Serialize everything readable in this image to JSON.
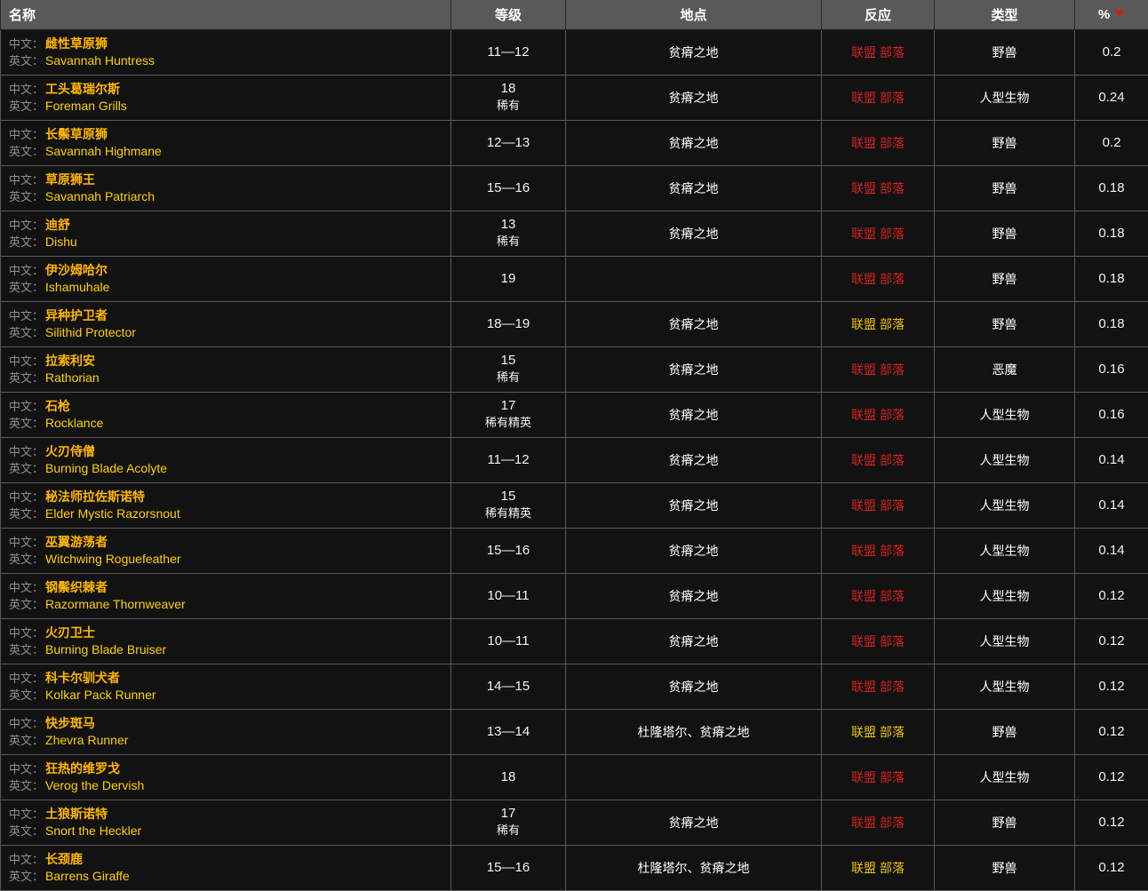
{
  "table": {
    "sort_indicator": "descending-caret",
    "accent_colors": {
      "header_background": "#595959",
      "row_background": "#121212",
      "grid_line": "#595959",
      "name_cn": "#ffb700",
      "name_en": "#ffd100",
      "label_grey": "#8f8f8f",
      "hostile_red": "#d32020",
      "neutral_yellow": "#e8c20a",
      "sort_caret_red": "#c62222"
    },
    "columns": [
      {
        "key": "name",
        "label": "名称"
      },
      {
        "key": "level",
        "label": "等级"
      },
      {
        "key": "location",
        "label": "地点"
      },
      {
        "key": "reaction",
        "label": "反应"
      },
      {
        "key": "type",
        "label": "类型"
      },
      {
        "key": "percent",
        "label": "%"
      }
    ],
    "labels": {
      "cn_prefix": "中文：",
      "en_prefix": "英文：",
      "alliance": "联盟",
      "horde": "部落"
    },
    "rows": [
      {
        "cn": "雌性草原狮",
        "en": "Savannah Huntress",
        "level": "11—12",
        "rank": "",
        "location": "贫瘠之地",
        "reaction": "hostile",
        "type": "野兽",
        "percent": "0.2"
      },
      {
        "cn": "工头葛瑞尔斯",
        "en": "Foreman Grills",
        "level": "18",
        "rank": "稀有",
        "location": "贫瘠之地",
        "reaction": "hostile",
        "type": "人型生物",
        "percent": "0.24"
      },
      {
        "cn": "长鬃草原狮",
        "en": "Savannah Highmane",
        "level": "12—13",
        "rank": "",
        "location": "贫瘠之地",
        "reaction": "hostile",
        "type": "野兽",
        "percent": "0.2"
      },
      {
        "cn": "草原狮王",
        "en": "Savannah Patriarch",
        "level": "15—16",
        "rank": "",
        "location": "贫瘠之地",
        "reaction": "hostile",
        "type": "野兽",
        "percent": "0.18"
      },
      {
        "cn": "迪舒",
        "en": "Dishu",
        "level": "13",
        "rank": "稀有",
        "location": "贫瘠之地",
        "reaction": "hostile",
        "type": "野兽",
        "percent": "0.18"
      },
      {
        "cn": "伊沙姆哈尔",
        "en": "Ishamuhale",
        "level": "19",
        "rank": "",
        "location": "",
        "reaction": "hostile",
        "type": "野兽",
        "percent": "0.18"
      },
      {
        "cn": "异种护卫者",
        "en": "Silithid Protector",
        "level": "18—19",
        "rank": "",
        "location": "贫瘠之地",
        "reaction": "neutral",
        "type": "野兽",
        "percent": "0.18"
      },
      {
        "cn": "拉索利安",
        "en": "Rathorian",
        "level": "15",
        "rank": "稀有",
        "location": "贫瘠之地",
        "reaction": "hostile",
        "type": "恶魔",
        "percent": "0.16"
      },
      {
        "cn": "石枪",
        "en": "Rocklance",
        "level": "17",
        "rank": "稀有精英",
        "location": "贫瘠之地",
        "reaction": "hostile",
        "type": "人型生物",
        "percent": "0.16"
      },
      {
        "cn": "火刃侍僧",
        "en": "Burning Blade Acolyte",
        "level": "11—12",
        "rank": "",
        "location": "贫瘠之地",
        "reaction": "hostile",
        "type": "人型生物",
        "percent": "0.14"
      },
      {
        "cn": "秘法师拉佐斯诺特",
        "en": "Elder Mystic Razorsnout",
        "level": "15",
        "rank": "稀有精英",
        "location": "贫瘠之地",
        "reaction": "hostile",
        "type": "人型生物",
        "percent": "0.14"
      },
      {
        "cn": "巫翼游荡者",
        "en": "Witchwing Roguefeather",
        "level": "15—16",
        "rank": "",
        "location": "贫瘠之地",
        "reaction": "hostile",
        "type": "人型生物",
        "percent": "0.14"
      },
      {
        "cn": "钢鬃织棘者",
        "en": "Razormane Thornweaver",
        "level": "10—11",
        "rank": "",
        "location": "贫瘠之地",
        "reaction": "hostile",
        "type": "人型生物",
        "percent": "0.12"
      },
      {
        "cn": "火刃卫士",
        "en": "Burning Blade Bruiser",
        "level": "10—11",
        "rank": "",
        "location": "贫瘠之地",
        "reaction": "hostile",
        "type": "人型生物",
        "percent": "0.12"
      },
      {
        "cn": "科卡尔驯犬者",
        "en": "Kolkar Pack Runner",
        "level": "14—15",
        "rank": "",
        "location": "贫瘠之地",
        "reaction": "hostile",
        "type": "人型生物",
        "percent": "0.12"
      },
      {
        "cn": "快步斑马",
        "en": "Zhevra Runner",
        "level": "13—14",
        "rank": "",
        "location": "杜隆塔尔、贫瘠之地",
        "reaction": "neutral",
        "type": "野兽",
        "percent": "0.12"
      },
      {
        "cn": "狂热的维罗戈",
        "en": "Verog the Dervish",
        "level": "18",
        "rank": "",
        "location": "",
        "reaction": "hostile",
        "type": "人型生物",
        "percent": "0.12"
      },
      {
        "cn": "土狼斯诺特",
        "en": "Snort the Heckler",
        "level": "17",
        "rank": "稀有",
        "location": "贫瘠之地",
        "reaction": "hostile",
        "type": "野兽",
        "percent": "0.12"
      },
      {
        "cn": "长颈鹿",
        "en": "Barrens Giraffe",
        "level": "15—16",
        "rank": "",
        "location": "杜隆塔尔、贫瘠之地",
        "reaction": "neutral",
        "type": "野兽",
        "percent": "0.12"
      }
    ]
  }
}
